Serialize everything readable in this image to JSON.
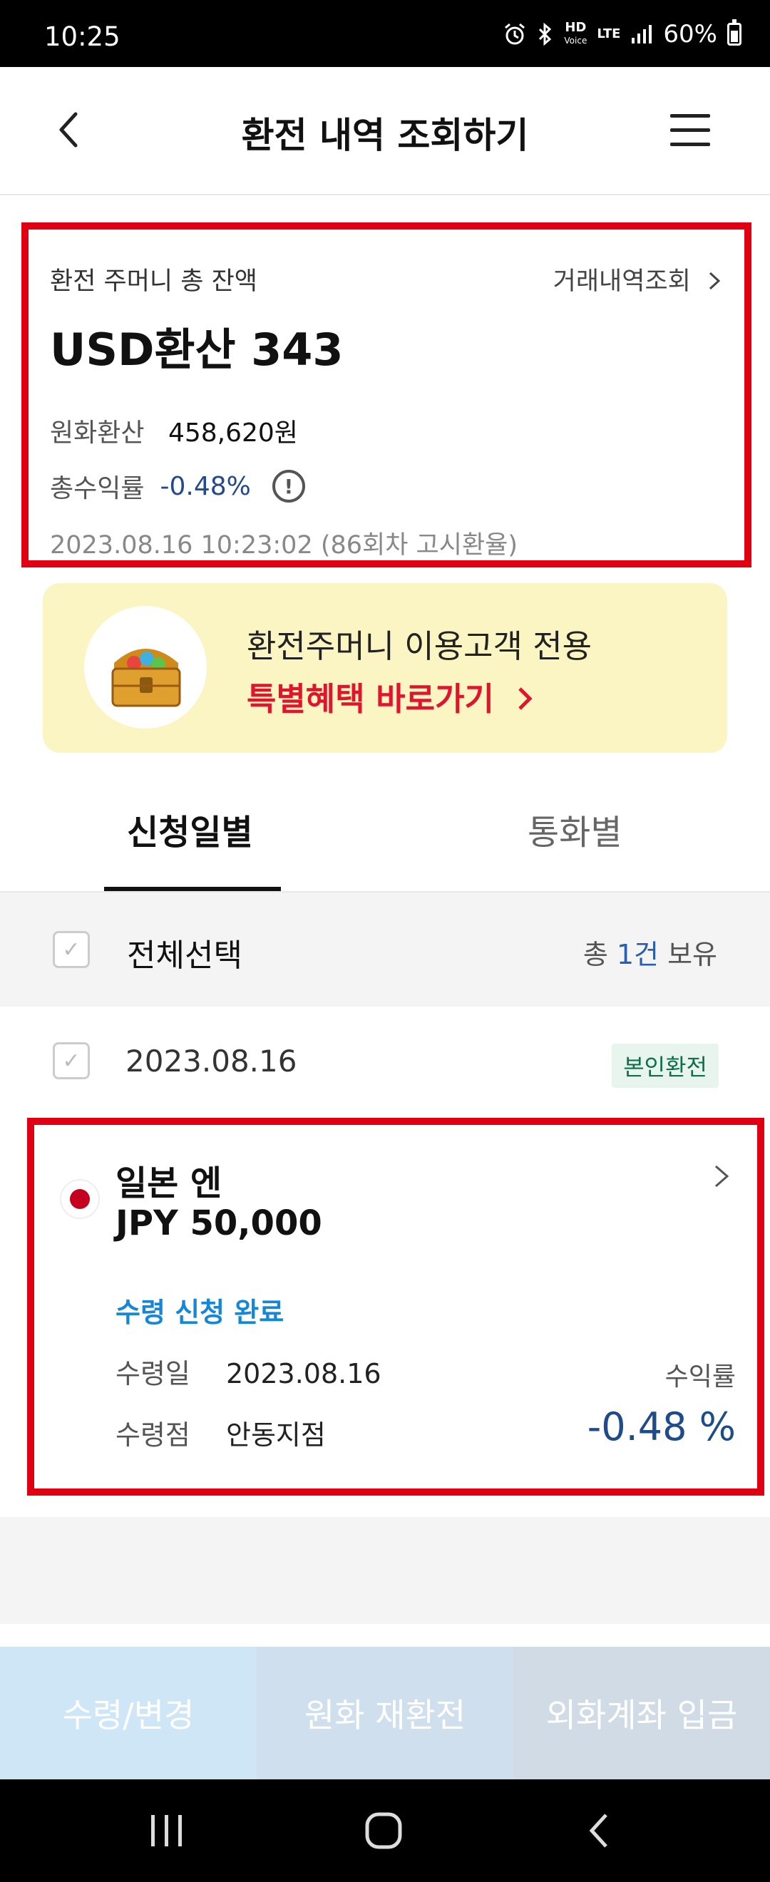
{
  "status_bar": {
    "time": "10:25",
    "hd_label": "HD",
    "voice_label": "Voice",
    "lte_label": "LTE",
    "battery_percent": "60%",
    "icons": [
      "alarm-icon",
      "bluetooth-icon",
      "signal-icon",
      "battery-icon"
    ]
  },
  "header": {
    "title": "환전 내역 조회하기",
    "icons": [
      "back-chevron-icon",
      "hamburger-menu-icon"
    ]
  },
  "summary": {
    "label": "환전 주머니 총 잔액",
    "history_link": "거래내역조회",
    "usd_amount": "USD환산 343",
    "krw_label": "원화환산",
    "krw_value": "458,620원",
    "return_label": "총수익률",
    "return_value": "-0.48%",
    "timestamp": "2023.08.16 10:23:02 (86회차 고시환율)"
  },
  "promo": {
    "line1": "환전주머니 이용고객 전용",
    "line2": "특별혜택 바로가기",
    "icon": "treasure-chest-icon"
  },
  "tabs": [
    {
      "label": "신청일별",
      "active": true
    },
    {
      "label": "통화별",
      "active": false
    }
  ],
  "select_row": {
    "label": "전체선택",
    "count_prefix": "총 ",
    "count_num": "1건",
    "count_suffix": " 보유"
  },
  "date_row": {
    "date": "2023.08.16",
    "badge": "본인환전"
  },
  "item": {
    "currency_name": "일본 엔",
    "amount": "JPY 50,000",
    "status": "수령 신청 완료",
    "receive_date_label": "수령일",
    "receive_date": "2023.08.16",
    "branch_label": "수령점",
    "branch": "안동지점",
    "return_label": "수익률",
    "return_value": "-0.48 %",
    "flag_icon": "japan-flag-icon"
  },
  "bottom_buttons": [
    "수령/변경",
    "원화 재환전",
    "외화계좌 입금"
  ],
  "colors": {
    "highlight_red": "#e00012",
    "promo_bg": "#fbf5c4",
    "promo_red": "#e0142c",
    "negative_blue": "#1e4b8a",
    "status_blue": "#1487d8",
    "badge_green": "#0e6f4d"
  }
}
